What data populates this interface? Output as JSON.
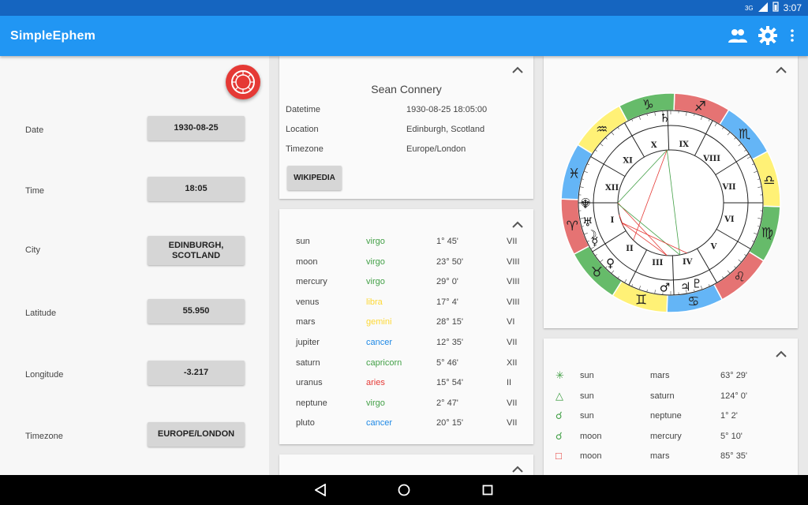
{
  "status": {
    "network": "3G",
    "time": "3:07"
  },
  "app": {
    "title": "SimpleEphem",
    "icons": [
      "people-icon",
      "settings-icon",
      "more-vert-icon"
    ]
  },
  "form": {
    "date": {
      "label": "Date",
      "value": "1930-08-25"
    },
    "time": {
      "label": "Time",
      "value": "18:05"
    },
    "city": {
      "label": "City",
      "value": "EDINBURGH, SCOTLAND"
    },
    "latitude": {
      "label": "Latitude",
      "value": "55.950"
    },
    "longitude": {
      "label": "Longitude",
      "value": "-3.217"
    },
    "timezone": {
      "label": "Timezone",
      "value": "EUROPE/LONDON"
    }
  },
  "person": {
    "name": "Sean Connery",
    "datetime_label": "Datetime",
    "datetime": "1930-08-25 18:05:00",
    "location_label": "Location",
    "location": "Edinburgh, Scotland",
    "timezone_label": "Timezone",
    "timezone": "Europe/London",
    "wiki_label": "WIKIPEDIA"
  },
  "planets": [
    {
      "name": "sun",
      "sign": "virgo",
      "deg": "1° 45'",
      "house": "VII",
      "color": "#43a047"
    },
    {
      "name": "moon",
      "sign": "virgo",
      "deg": "23° 50'",
      "house": "VIII",
      "color": "#43a047"
    },
    {
      "name": "mercury",
      "sign": "virgo",
      "deg": "29° 0'",
      "house": "VIII",
      "color": "#43a047"
    },
    {
      "name": "venus",
      "sign": "libra",
      "deg": "17° 4'",
      "house": "VIII",
      "color": "#fdd835"
    },
    {
      "name": "mars",
      "sign": "gemini",
      "deg": "28° 15'",
      "house": "VI",
      "color": "#fdd835"
    },
    {
      "name": "jupiter",
      "sign": "cancer",
      "deg": "12° 35'",
      "house": "VII",
      "color": "#1e88e5"
    },
    {
      "name": "saturn",
      "sign": "capricorn",
      "deg": "5° 46'",
      "house": "XII",
      "color": "#43a047"
    },
    {
      "name": "uranus",
      "sign": "aries",
      "deg": "15° 54'",
      "house": "II",
      "color": "#e53935"
    },
    {
      "name": "neptune",
      "sign": "virgo",
      "deg": "2° 47'",
      "house": "VII",
      "color": "#43a047"
    },
    {
      "name": "pluto",
      "sign": "cancer",
      "deg": "20° 15'",
      "house": "VII",
      "color": "#1e88e5"
    }
  ],
  "aspects": [
    {
      "symbol": "✳",
      "symbol_color": "#43a047",
      "p1": "sun",
      "p2": "mars",
      "deg": "63° 29'"
    },
    {
      "symbol": "△",
      "symbol_color": "#43a047",
      "p1": "sun",
      "p2": "saturn",
      "deg": "124° 0'"
    },
    {
      "symbol": "☌",
      "symbol_color": "#43a047",
      "p1": "sun",
      "p2": "neptune",
      "deg": "1° 2'"
    },
    {
      "symbol": "☌",
      "symbol_color": "#43a047",
      "p1": "moon",
      "p2": "mercury",
      "deg": "5° 10'"
    },
    {
      "symbol": "□",
      "symbol_color": "#e53935",
      "p1": "moon",
      "p2": "mars",
      "deg": "85° 35'"
    }
  ],
  "chart": {
    "signs": [
      "♈",
      "♉",
      "♊",
      "♋",
      "♌",
      "♍",
      "♎",
      "♏",
      "♐",
      "♑",
      "♒",
      "♓"
    ],
    "sign_colors": [
      "#e57373",
      "#66bb6a",
      "#fff176",
      "#64b5f6",
      "#e57373",
      "#66bb6a",
      "#fff176",
      "#64b5f6",
      "#e57373",
      "#66bb6a",
      "#fff176",
      "#64b5f6"
    ],
    "houses": [
      "I",
      "II",
      "III",
      "IV",
      "V",
      "VI",
      "VII",
      "VIII",
      "IX",
      "X",
      "XI",
      "XII"
    ],
    "planet_glyphs": [
      "☉",
      "☽",
      "☿",
      "♀",
      "♂",
      "♃",
      "♄",
      "♅",
      "♆",
      "♇"
    ]
  }
}
